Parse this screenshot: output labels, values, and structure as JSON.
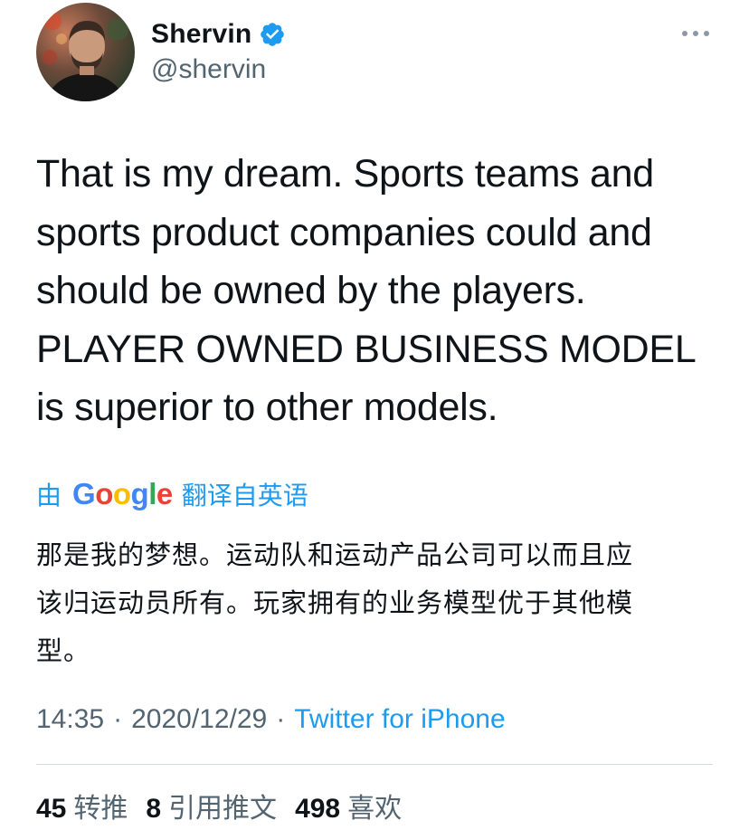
{
  "author": {
    "display_name": "Shervin",
    "handle": "@shervin",
    "verified": true
  },
  "tweet": {
    "text_lines": [
      "That is my dream. Sports teams and",
      "sports product companies could and",
      "should be owned by the players.",
      "PLAYER OWNED BUSINESS MODEL",
      "is superior to other models."
    ]
  },
  "translation": {
    "prefix": "由",
    "provider": "Google",
    "suffix": "翻译自英语",
    "text_lines": [
      "那是我的梦想。运动队和运动产品公司可以而且应",
      "该归运动员所有。玩家拥有的业务模型优于其他模",
      "型。"
    ]
  },
  "meta": {
    "time": "14:35",
    "separator": "·",
    "date": "2020/12/29",
    "source": "Twitter for iPhone"
  },
  "stats": {
    "retweets_count": "45",
    "retweets_label": "转推",
    "quotes_count": "8",
    "quotes_label": "引用推文",
    "likes_count": "498",
    "likes_label": "喜欢"
  },
  "colors": {
    "link_blue": "#1d9bf0",
    "secondary_text": "#536471",
    "primary_text": "#0f1419",
    "google_blue": "#4285f4",
    "google_red": "#ea4335",
    "google_yellow": "#fbbc05",
    "google_green": "#34a853"
  },
  "icons": {
    "verified": "verified-badge-icon",
    "more": "more-horizontal-icon"
  }
}
